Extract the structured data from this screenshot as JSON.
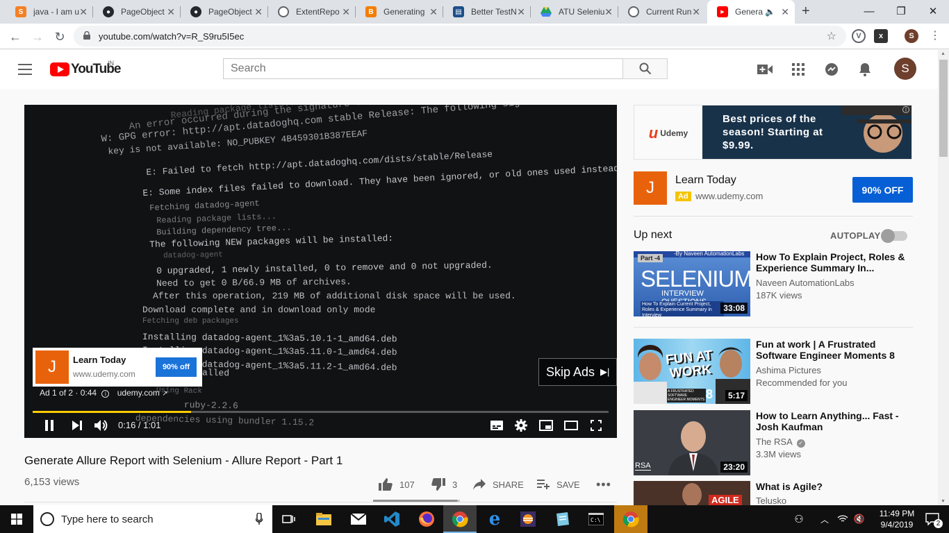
{
  "browser": {
    "tabs": [
      {
        "title": "java - I am u",
        "icon": "stackoverflow-icon",
        "color": "#f48024",
        "active": false
      },
      {
        "title": "PageObject",
        "icon": "github-icon",
        "color": "#24292e",
        "active": false
      },
      {
        "title": "PageObject",
        "icon": "github-icon",
        "color": "#24292e",
        "active": false
      },
      {
        "title": "ExtentRepo",
        "icon": "globe-icon",
        "color": "#5f6368",
        "active": false
      },
      {
        "title": "Generating",
        "icon": "blogger-icon",
        "color": "#f57d00",
        "active": false
      },
      {
        "title": "Better TestN",
        "icon": "book-icon",
        "color": "#1b4f8a",
        "active": false
      },
      {
        "title": "ATU Seleniu",
        "icon": "drive-icon",
        "color": "#1fa463",
        "active": false
      },
      {
        "title": "Current Run",
        "icon": "globe-icon",
        "color": "#5f6368",
        "active": false
      },
      {
        "title": "Genera",
        "icon": "youtube-icon",
        "color": "#ff0000",
        "active": true
      }
    ],
    "new_tab": "+",
    "url": "youtube.com/watch?v=R_S9ru5I5ec",
    "profile_initial": "S"
  },
  "youtube": {
    "logo_text": "YouTube",
    "country": "IN",
    "search_placeholder": "Search",
    "avatar_initial": "S"
  },
  "player": {
    "terminal_lines": [
      "Reading package lists...",
      "An error occurred during the signature verification. The repository is not updated",
      "W: GPG error: http://apt.datadoghq.com stable Release: The following signatures couldn't be verified",
      "key is not available: NO_PUBKEY 4B459301B387EEAF",
      "E: Failed to fetch http://apt.datadoghq.com/dists/stable/Release",
      "E: Some index files failed to download. They have been ignored, or old ones used instead.",
      "Fetching datadog-agent",
      "Reading package lists...",
      "Building dependency tree...",
      "The following NEW packages will be installed:",
      "  datadog-agent",
      "0 upgraded, 1 newly installed, 0 to remove and 0 not upgraded.",
      "Need to get 0 B/66.9 MB of archives.",
      "After this operation, 219 MB of additional disk space will be used.",
      "Download complete and in download only mode",
      "Fetching deb packages",
      "Installing datadog-agent_1%3a5.10.1-1_amd64.deb",
      "Installing datadog-agent_1%3a5.11.0-1_amd64.deb",
      "Installing datadog-agent_1%3a5.11.2-1_amd64.deb",
      "  installed",
      "Using Rack",
      "  ruby-2.2.6",
      "dependencies using bundler 1.15.2"
    ],
    "ad_overlay": {
      "initial": "J",
      "advertiser": "Learn Today",
      "domain": "www.udemy.com",
      "cta": "90% off"
    },
    "ad_info": "Ad 1 of 2 · 0:44",
    "ad_link": "udemy.com",
    "skip_label": "Skip Ads",
    "time": "0:16 / 1:01",
    "progress_fraction": 0.275
  },
  "video": {
    "title": "Generate Allure Report with Selenium - Allure Report - Part 1",
    "views": "6,153 views",
    "likes": "107",
    "dislikes": "3",
    "share_label": "SHARE",
    "save_label": "SAVE",
    "like_ratio": 0.973
  },
  "sidebar": {
    "banner_text": "Best prices of the season! Starting at $9.99.",
    "banner_brand": "Udemy",
    "companion": {
      "initial": "J",
      "advertiser": "Learn Today",
      "badge": "Ad",
      "domain": "www.udemy.com",
      "cta": "90% OFF"
    },
    "up_next_label": "Up next",
    "autoplay_label": "AUTOPLAY",
    "autoplay_on": false,
    "videos": [
      {
        "title": "How To Explain Project, Roles & Experience Summary In...",
        "channel": "Naveen AutomationLabs",
        "meta": "187K views",
        "duration": "33:08",
        "thumb_text": "SELENIUM",
        "thumb_sub": "INTERVIEW QUESTIONS",
        "thumb_tag": "Part -4",
        "thumb_caption": "How To Explain Current Project, Roles & Experience Summary in Interview",
        "thumb_top": "-By Naveen AutomationLabs"
      },
      {
        "title": "Fun at work | A Frustrated Software Engineer Moments 8",
        "channel": "Ashima Pictures",
        "meta": "Recommended for you",
        "duration": "5:17",
        "thumb_text": "FUN AT WORK",
        "thumb_sub": "A FRUSTRATED SOFTWARE ENGINEER MOMENTS",
        "thumb_num": "8"
      },
      {
        "title": "How to Learn Anything... Fast - Josh Kaufman",
        "channel": "The RSA",
        "meta": "3.3M views",
        "duration": "23:20",
        "thumb_text": "RSA",
        "verified": true
      },
      {
        "title": "What is Agile?",
        "channel": "Telusko",
        "meta": "",
        "duration": "",
        "thumb_text": "AGILE"
      }
    ]
  },
  "taskbar": {
    "search_placeholder": "Type here to search",
    "time": "11:49 PM",
    "date": "9/4/2019",
    "notifications": "2"
  }
}
